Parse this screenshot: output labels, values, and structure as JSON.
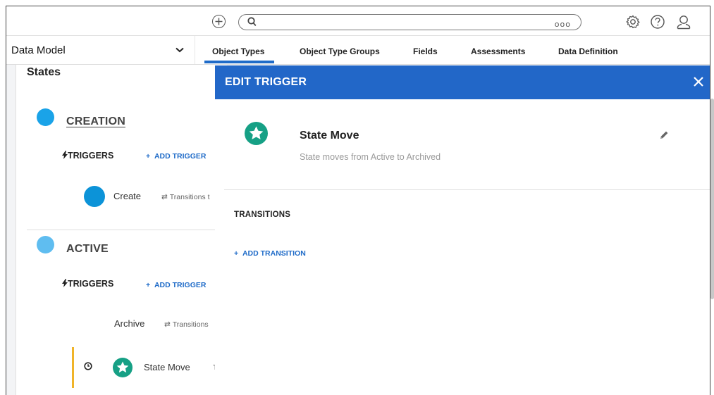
{
  "topbar": {
    "search_placeholder": "",
    "more_icon": "ooo",
    "icons": [
      "add-circle-icon",
      "search-icon",
      "more-icon",
      "gear-icon",
      "help-icon",
      "user-icon"
    ]
  },
  "nav": {
    "model_select": "Data Model",
    "tabs": [
      "Object Types",
      "Object Type Groups",
      "Fields",
      "Assessments",
      "Data Definition"
    ],
    "active_tab": "Object Types"
  },
  "states": {
    "title": "States",
    "items": [
      {
        "name": "CREATION",
        "color": "#1aa3e8",
        "triggers_label": "TRIGGERS",
        "add_trigger": "ADD TRIGGER",
        "entries": [
          {
            "label": "Create",
            "transition": "Transitions t"
          }
        ]
      },
      {
        "name": "ACTIVE",
        "color": "#5fbdf0",
        "triggers_label": "TRIGGERS",
        "add_trigger": "ADD TRIGGER",
        "entries": [
          {
            "label": "Archive",
            "transition": "Transitions"
          },
          {
            "label": "State Move",
            "transition": "T"
          }
        ]
      }
    ]
  },
  "modal": {
    "title": "EDIT TRIGGER",
    "trigger_name": "State Move",
    "trigger_description": "State moves from Active to Archived",
    "transitions_label": "TRANSITIONS",
    "add_transition": "ADD TRANSITION"
  },
  "colors": {
    "accent": "#2267c8",
    "trigger_icon": "#16a085",
    "highlight_bar": "#f0b429"
  }
}
